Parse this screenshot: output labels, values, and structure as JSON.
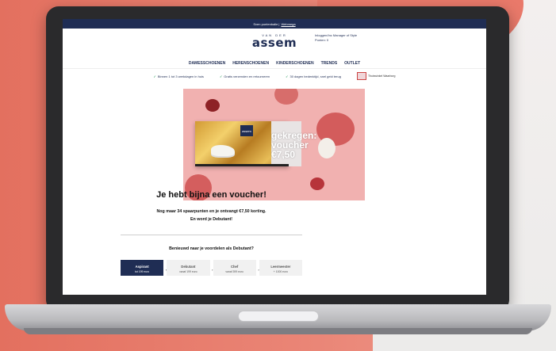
{
  "topbar": {
    "text": "Sven puntenbalie |",
    "link": "Webmega"
  },
  "header": {
    "logo_small": "VAN DER",
    "logo": "assem",
    "greeting_line1": "Inloggen/Inc  Manager of Style",
    "greeting_line2": "Punten: 0"
  },
  "nav": [
    "DAMESSCHOENEN",
    "HERENSCHOENEN",
    "KINDERSCHOENEN",
    "TRENDS",
    "OUTLET"
  ],
  "usp": [
    {
      "text": "Binnen 1 tot 3 werkdagen in huis"
    },
    {
      "text": "Gratis verzenden en retourneren"
    },
    {
      "text": "30 dagen bedenktijd, snel geld terug"
    }
  ],
  "badge": {
    "text": "Thuiswinkel Waarborg"
  },
  "hero": {
    "card_logo": "assem",
    "card_text": "gekregen: voucher €7,50"
  },
  "main": {
    "headline": "Je hebt bijna een voucher!",
    "line1": "Nog maar 34 spaarpunten en je ontvangt €7,50 korting.",
    "line2": "En word je Debutant!",
    "benefits_q": "Benieuwd naar je voordelen als Debutant?"
  },
  "tiers": [
    {
      "name": "Aspirant",
      "sub": "tot 199 euro",
      "active": true
    },
    {
      "name": "Debutant",
      "sub": "vanaf 199 euro"
    },
    {
      "name": "Chef",
      "sub": "vanaf 399 euro"
    },
    {
      "name": "Leermeester",
      "sub": "+ 1000 euro"
    }
  ],
  "colors": {
    "navy": "#1f2d54",
    "pink_bg": "#e9796a",
    "hero_pink": "#f1b1b0"
  }
}
